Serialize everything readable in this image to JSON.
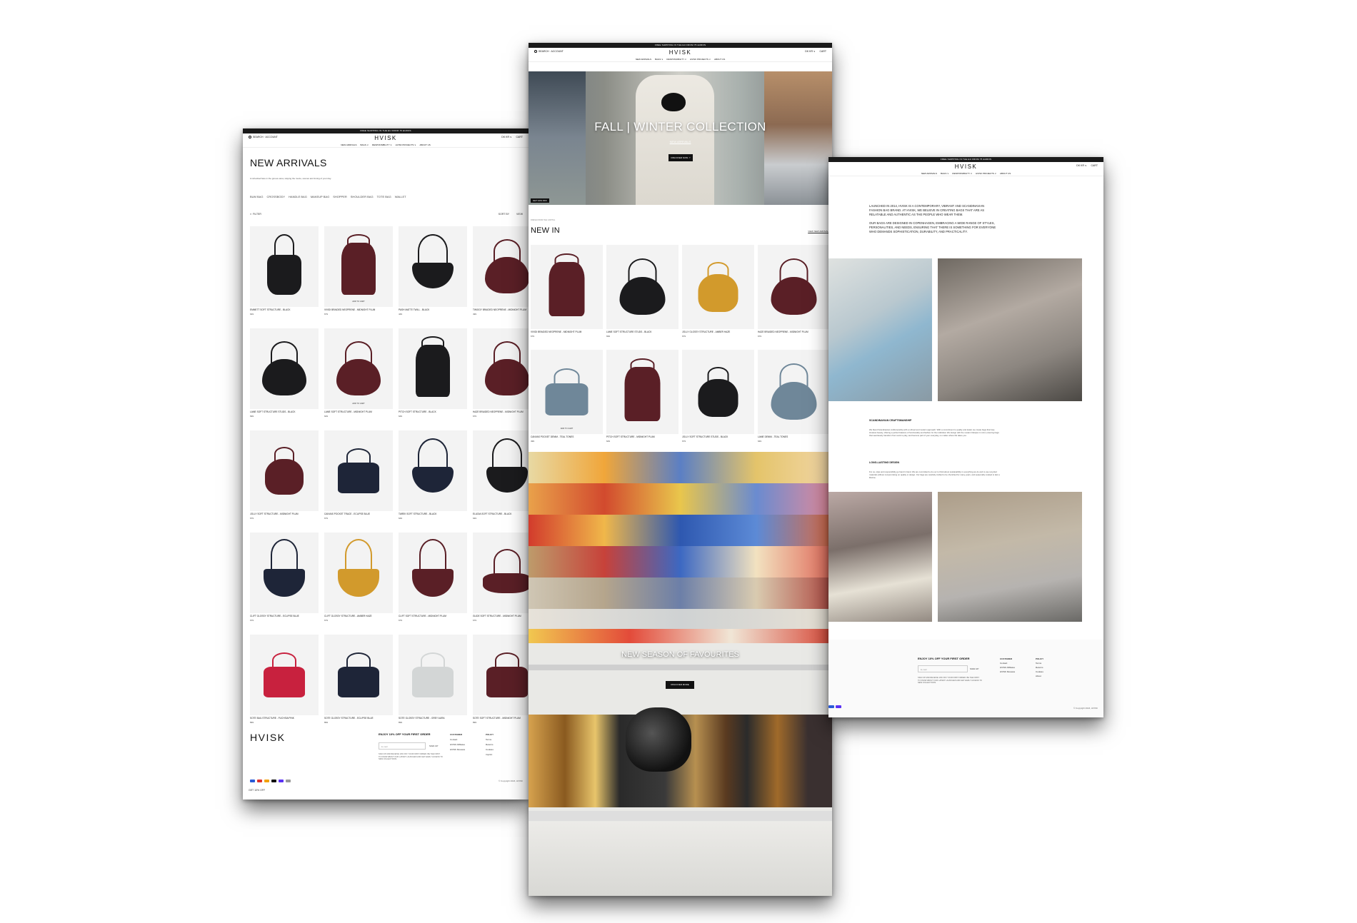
{
  "site": {
    "logo": "HVISK",
    "announcement": "FREE SHIPPING IN THE EU FROM 75 EUROS",
    "search_label": "SEARCH · ACCOUNT",
    "currency": "DK KR ∨",
    "cart": "CART",
    "nav": [
      "NEW ARRIVALS",
      "BAGS ∨",
      "RESPONSIBILITY ∨",
      "HVISK PROJECTS ∨",
      "ABOUT US"
    ]
  },
  "left_page": {
    "title": "NEW ARRIVALS",
    "description": "A refreshed face in the groove area, staying the movie, scenes and timing of your day.",
    "categories": [
      "BUM BAG",
      "CROSSBODY",
      "HANDLE BAG",
      "MAKEUP BAG",
      "SHOPPER",
      "SHOULDER BAG",
      "TOTE BAG",
      "WALLET"
    ],
    "filter_label": "FILTER",
    "sort_label": "SORT BY",
    "view_label": "VIEW",
    "products": [
      {
        "name": "EMMETT SOFT STRUCTURE - BLACK",
        "price": "649"
      },
      {
        "name": "VIVIDI BRAIDED NEOPRENE - MIDNIGHT PLUM",
        "price": "679",
        "badge": "ADD TO CART"
      },
      {
        "name": "PASH MATTE TWILL - BLACK",
        "price": "449"
      },
      {
        "name": "TWIGGY BRAIDED NEOPRENE - MIDNIGHT PLUM",
        "price": "499"
      },
      {
        "name": "LAME SOFT STRUCTURE STUDS - BLACK",
        "price": "699"
      },
      {
        "name": "LAME SOFT STRUCTURE - MIDNIGHT PLUM",
        "price": "649",
        "badge": "ADD TO CART"
      },
      {
        "name": "PITCH SOFT STRUCTURE - BLACK",
        "price": "649"
      },
      {
        "name": "HAZE BRAIDED NEOPRENE - MIDNIGHT PLUM",
        "price": "679"
      },
      {
        "name": "JOLLY SOFT STRUCTURE - MIDNIGHT PLUM",
        "price": "679"
      },
      {
        "name": "CANVAS POCKET TRACE - ECLIPSE BLUE",
        "price": "679"
      },
      {
        "name": "TAREK SOFT STRUCTURE - BLACK",
        "price": "649"
      },
      {
        "name": "ELUDIA SOFT STRUCTURE - BLACK",
        "price": "649"
      },
      {
        "name": "CLIFT GLOSSY STRUCTURE - ECLIPSE BLUE",
        "price": "679"
      },
      {
        "name": "CLIFT GLOSSY STRUCTURE - AMBER HAZE",
        "price": "679"
      },
      {
        "name": "CLIFT SOFT STRUCTURE - MIDNIGHT PLUM",
        "price": "679"
      },
      {
        "name": "GLIDE SOFT STRUCTURE - MIDNIGHT PLUM",
        "price": "679"
      },
      {
        "name": "SOTE BAIL STRUCTURE - FUCHSIA PINK",
        "price": "899"
      },
      {
        "name": "SOTE GLOSSY STRUCTURE - ECLIPSE BLUE",
        "price": "899"
      },
      {
        "name": "SOTE GLOSSY STRUCTURE - GREY AURA",
        "price": "899"
      },
      {
        "name": "SOTE SOFT STRUCTURE - MIDNIGHT PLUM",
        "price": "899"
      }
    ],
    "footer": {
      "logo": "HVISK",
      "newsletter_title": "ENJOY 10% OFF YOUR FIRST ORDER",
      "email_placeholder": "E-mail",
      "signup": "SIGN UP",
      "small_print": "SIGN UP AND RECEIVE 10% OFF YOUR FIRST ORDER. BE THE FIRST TO KNOW ABOUT OUR LATEST LAUNCHES AND GET EARLY ACCESS TO NEW COLLECTIONS.",
      "col1_title": "CUSTOMER",
      "col1": [
        "Contact",
        "HVISK Affiliates",
        "HVISK Reviews"
      ],
      "col2_title": "POLICY",
      "col2": [
        "Terms",
        "Returns",
        "Cookies",
        "Imprint"
      ],
      "copyright": "© Copyright 2024, HVISK",
      "get_off": "GET 10% OFF"
    }
  },
  "center_page": {
    "hero_title": "FALL | WINTER COLLECTION",
    "hero_link": "NEW ARRIVALS",
    "hero_button": "DISCOVER NOW ↗",
    "get_off": "GET 10% OFF",
    "breadcrumb": "FRESH FROM THE CAPITAL",
    "section_title": "NEW IN",
    "view_all": "VIEW NEW ARRIVALS",
    "products": [
      {
        "name": "VIVIDI BRAIDED NEOPRENE - MIDNIGHT PLUM",
        "price": "679"
      },
      {
        "name": "LAME SOFT STRUCTURE STUDS - BLACK",
        "price": "699"
      },
      {
        "name": "JOLLY GLOSSY STRUCTURE - AMBER HAZE",
        "price": "679"
      },
      {
        "name": "HAZE BRAIDED NEOPRENE - MIDNIGHT PLUM",
        "price": "679"
      },
      {
        "name": "CANVAS POCKET DENIM - TEAL TONES",
        "price": "499",
        "badge": "ADD TO CART"
      },
      {
        "name": "PITCH SOFT STRUCTURE - MIDNIGHT PLUM",
        "price": "649"
      },
      {
        "name": "JOLLY SOFT STRUCTURE STUDS - BLACK",
        "price": "679"
      },
      {
        "name": "LAME DENIM - TEAL TONES",
        "price": "649"
      }
    ],
    "promo_title": "NEW SEASON OF FAVOURITES",
    "promo_button": "DISCOVER MORE"
  },
  "right_page": {
    "intro_1": "LAUNCHED IN 2014, HVISK IS A CONTEMPORARY, VIBRANT AND SCANDINAVIAN FASHION BAG BRAND. AT HVISK, WE BELIEVE IN CREATING BAGS THAT ARE AS RELATABLE AND AUTHENTIC AS THE PEOPLE WHO WEAR THEM.",
    "intro_2": "OUR BAGS ARE DESIGNED IN COPENHAGEN, EMBRACING A WIDE RANGE OF STYLES, PERSONALITIES, AND NEEDS, ENSURING THAT THERE IS SOMETHING FOR EVERYONE WHO DEMANDS SOPHISTICATION, DURABILITY, AND PRACTICALITY.",
    "craft_title": "SCANDINAVIAN CRAFTSMANSHIP",
    "craft_text": "We blend Scandinavian craftsmanship with a refined and modern approach. With a commitment to quality and detail, we create bags that fuse timeless beauty, offering a perfect balance of functionality and fashion for the individual. We design with the modern lifestyle in mind, ensuring bags that seamlessly transition from work to play, and become part of your everyday, no matter where life takes you.",
    "lasting_title": "LONG-LASTING DESIGN",
    "lasting_text": "For us, style and responsibility go hand in hand. We are committed to do our to think about sustainability in everything we do and to use recycled materials without compromising on quality or design. Our bags are carefully crafted to be cherished for many years, and seasonally curated to last a lifetime.",
    "footer": {
      "newsletter_title": "ENJOY 10% OFF YOUR FIRST ORDER",
      "email_placeholder": "E-mail",
      "signup": "SIGN UP",
      "small_print": "SIGN UP AND RECEIVE 10% OFF YOUR FIRST ORDER. BE THE FIRST TO KNOW ABOUT OUR LATEST LAUNCHES AND GET EARLY ACCESS TO NEW COLLECTIONS.",
      "col1_title": "CUSTOMER",
      "col1": [
        "Contact",
        "HVISK Affiliates",
        "HVISK Reviews"
      ],
      "col2_title": "POLICY",
      "col2": [
        "Terms",
        "Returns",
        "Cookies",
        "About"
      ],
      "copyright": "© Copyright 2024, HVISK"
    }
  },
  "colors": {
    "black_bag": "#1b1b1d",
    "plum": "#5a1f26",
    "amber": "#d29a2c",
    "navy": "#1e2538",
    "fuchsia": "#c8213e",
    "grey_aura": "#d3d6d6",
    "denim": "#6f8799"
  }
}
